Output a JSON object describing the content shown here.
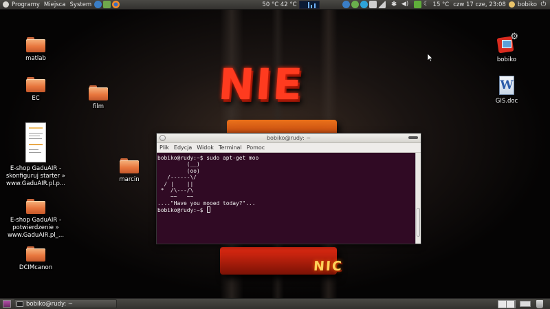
{
  "top_panel": {
    "menus": [
      "Programy",
      "Miejsca",
      "System"
    ],
    "temps": "50 °C 42 °C",
    "weather": "15 °C",
    "clock": "czw 17 cze, 23:08",
    "user": "bobiko"
  },
  "wallpaper": {
    "words": [
      "NIE",
      "NIC"
    ]
  },
  "desktop_icons": [
    {
      "label": "matlab"
    },
    {
      "label": "EC"
    },
    {
      "label": "film"
    },
    {
      "label": "E-shop GaduAIR - skonfiguruj starter » www.GaduAIR.pl.p..."
    },
    {
      "label": "marcin"
    },
    {
      "label": "E-shop GaduAIR - potwierdzenie » www.GaduAIR.pl_..."
    },
    {
      "label": "DCIMcanon"
    },
    {
      "label": "bobiko"
    },
    {
      "label": "GIS.doc"
    }
  ],
  "terminal": {
    "title": "bobiko@rudy: ~",
    "menu": [
      "Plik",
      "Edycja",
      "Widok",
      "Terminal",
      "Pomoc"
    ],
    "lines": [
      "bobiko@rudy:~$ sudo apt-get moo",
      "         (__)",
      "         (oo)",
      "   /------\\/",
      "  / |    ||",
      " *  /\\---/\\",
      "    ~~   ~~",
      "....\"Have you mooed today?\"...",
      "bobiko@rudy:~$ "
    ]
  },
  "bottom_panel": {
    "task_label": "bobiko@rudy: ~"
  },
  "colors": {
    "terminal_bg": "#300a24",
    "panel": "#3c3b37",
    "folder_orange": "#e8773e",
    "wallpaper_red": "#ff3b1f"
  }
}
